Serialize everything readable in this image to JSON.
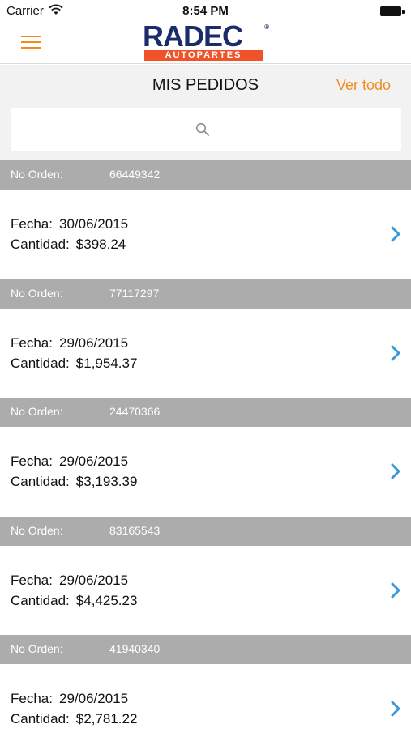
{
  "status_bar": {
    "carrier": "Carrier",
    "time": "8:54 PM"
  },
  "nav": {
    "logo_text": "RADEC",
    "logo_registered": "®",
    "logo_subtitle": "AUTOPARTES",
    "menu_icon": "hamburger-icon"
  },
  "header": {
    "title": "MIS PEDIDOS",
    "view_all_label": "Ver todo"
  },
  "search": {
    "placeholder": "",
    "icon": "search-icon"
  },
  "labels": {
    "order_number": "No Orden:",
    "date": "Fecha:",
    "amount": "Cantidad:"
  },
  "orders": [
    {
      "number": "66449342",
      "date": "30/06/2015",
      "amount": "$398.24"
    },
    {
      "number": "77117297",
      "date": "29/06/2015",
      "amount": "$1,954.37"
    },
    {
      "number": "24470366",
      "date": "29/06/2015",
      "amount": "$3,193.39"
    },
    {
      "number": "83165543",
      "date": "29/06/2015",
      "amount": "$4,425.23"
    },
    {
      "number": "41940340",
      "date": "29/06/2015",
      "amount": "$2,781.22"
    }
  ],
  "colors": {
    "accent": "#f28c1e",
    "chevron": "#3a9ad9",
    "section_header": "#acacac",
    "logo_blue": "#1b2c6b",
    "logo_orange": "#f0522a"
  }
}
